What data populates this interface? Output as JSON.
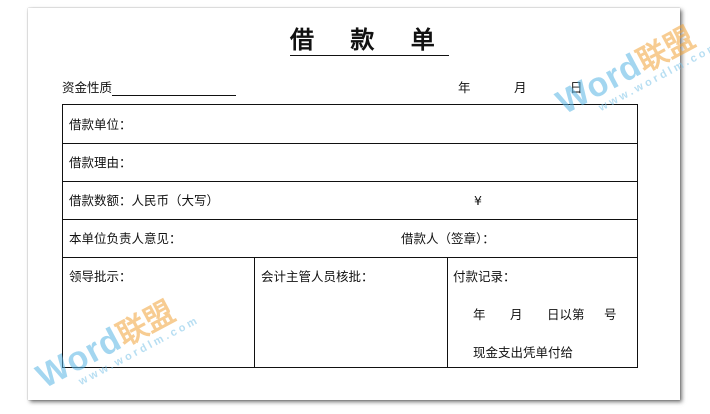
{
  "title": "借 款 单",
  "header": {
    "nature_label": "资金性质",
    "year": "年",
    "month": "月",
    "day": "日"
  },
  "rows": {
    "unit": "借款单位：",
    "reason": "借款理由：",
    "amount": "借款数额：人民币（大写）",
    "yen": "¥",
    "opinion": "本单位负责人意见：",
    "borrower": "借款人（签章）："
  },
  "bottom": {
    "leader": "领导批示：",
    "accountant": "会计主管人员核批：",
    "payment_title": "付款记录：",
    "year": "年",
    "month": "月",
    "day_no": "日以第",
    "hao": "号",
    "voucher": "现金支出凭单付给"
  },
  "watermark": {
    "brand_en": "Word",
    "brand_cn": "联盟",
    "url": "www.wordlm.com"
  }
}
